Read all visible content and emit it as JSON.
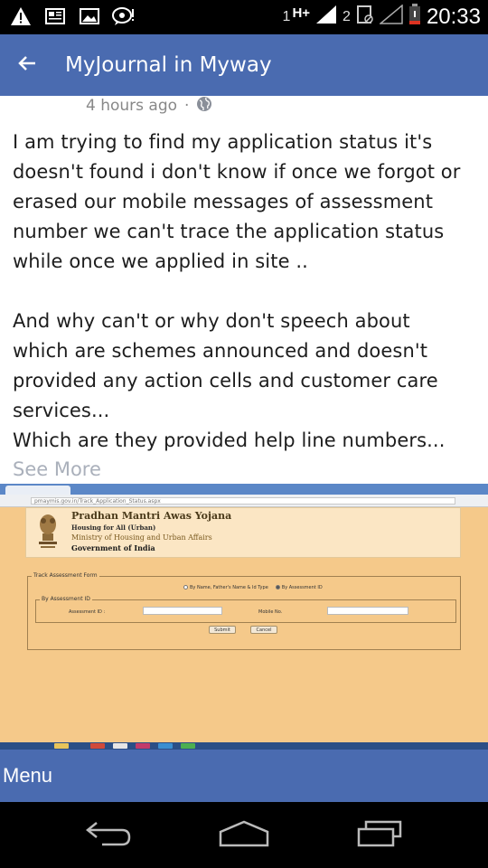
{
  "status_bar": {
    "sim_slot": "1",
    "network_type": "H+",
    "sim_slot_2": "2",
    "time": "20:33",
    "icons": [
      "warning-icon",
      "news-icon",
      "image-icon",
      "chat-alert-icon",
      "signal-icon",
      "battery-icon"
    ]
  },
  "app_bar": {
    "title": "MyJournal in Myway",
    "back_icon": "arrow-back-icon"
  },
  "post": {
    "time_ago": "4 hours ago",
    "separator": "·",
    "privacy_icon": "globe-icon",
    "paragraph_1": "I am trying to find my application status it's\ndoesn't found i don't know if once we forgot or\nerased our mobile messages of assessment\nnumber we can't trace the application status\nwhile once we applied in site ..",
    "paragraph_2": "And why can't or why don't speech about\nwhich are schemes announced and doesn't\nprovided any action cells and customer care\nservices...\nWhich are they provided help line numbers...",
    "see_more": "See More"
  },
  "embedded_screenshot": {
    "url": "pmaymis.gov.in/Track_Application_Status.aspx",
    "header": {
      "line1": "Pradhan Mantri Awas Yojana",
      "line2": "Housing for All (Urban)",
      "line3": "Ministry of Housing and Urban Affairs",
      "line4": "Government of India"
    },
    "form_title": "Track Assessment Form",
    "radio_option_1": "By Name, Father's Name & Id Type",
    "radio_option_2": "By Assessment ID",
    "section_title": "By Assessment ID",
    "assessment_label": "Assessment ID :",
    "mobile_label": "Mobile No.",
    "submit_label": "Submit",
    "cancel_label": "Cancel"
  },
  "menu_bar": {
    "label": "Menu"
  },
  "nav_bar": {
    "buttons": [
      "back-nav-icon",
      "home-nav-icon",
      "recents-nav-icon"
    ]
  },
  "colors": {
    "app_bar": "#4a6bb0",
    "status_bar": "#000000",
    "embedded_bg": "#f5c98a",
    "see_more": "#aab0bb"
  }
}
